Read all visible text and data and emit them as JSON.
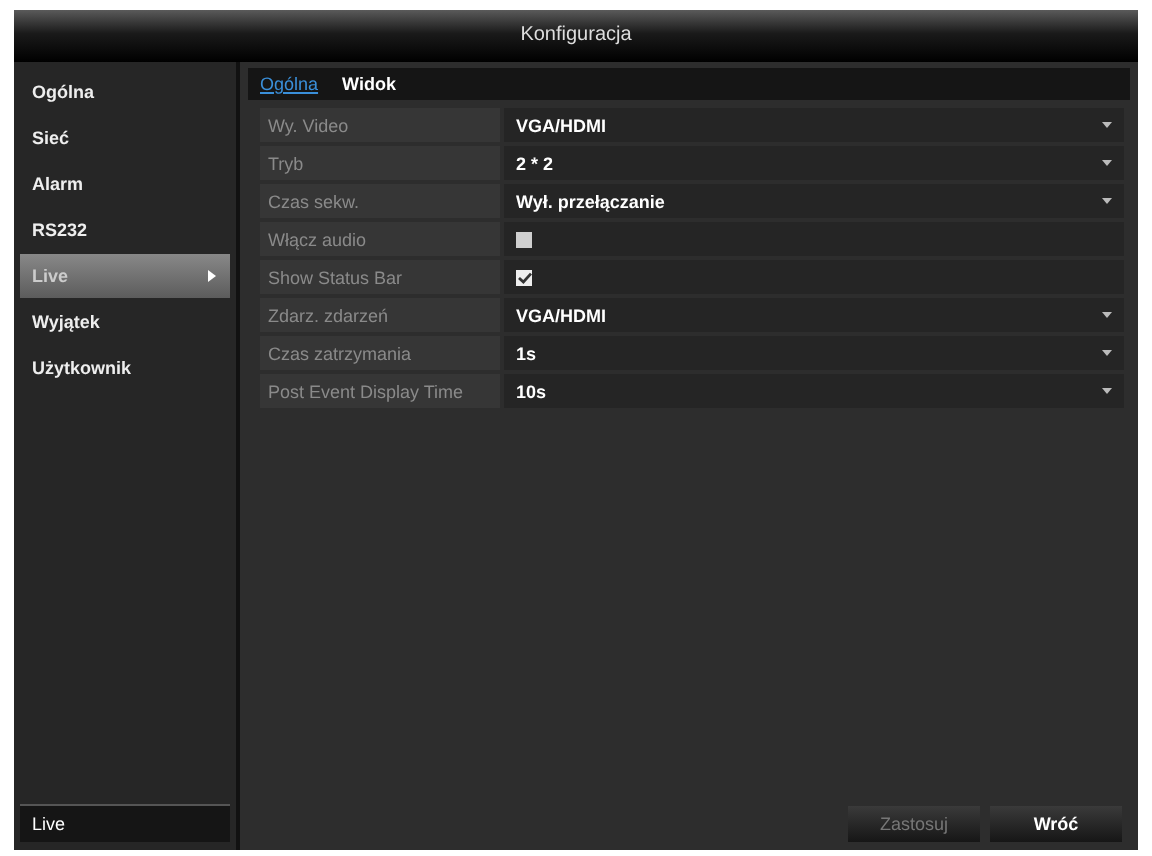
{
  "window": {
    "title": "Konfiguracja"
  },
  "sidebar": {
    "items": [
      {
        "label": "Ogólna",
        "selected": false
      },
      {
        "label": "Sieć",
        "selected": false
      },
      {
        "label": "Alarm",
        "selected": false
      },
      {
        "label": "RS232",
        "selected": false
      },
      {
        "label": "Live",
        "selected": true
      },
      {
        "label": "Wyjątek",
        "selected": false
      },
      {
        "label": "Użytkownik",
        "selected": false
      }
    ],
    "footer": "Live"
  },
  "tabs": [
    {
      "label": "Ogólna",
      "selected": true
    },
    {
      "label": "Widok",
      "selected": false
    }
  ],
  "settings": [
    {
      "kind": "select",
      "label": "Wy. Video",
      "value": "VGA/HDMI"
    },
    {
      "kind": "select",
      "label": "Tryb",
      "value": "2 * 2"
    },
    {
      "kind": "select",
      "label": "Czas sekw.",
      "value": "Wył. przełączanie"
    },
    {
      "kind": "checkbox",
      "label": "Włącz audio",
      "checked": false
    },
    {
      "kind": "checkbox",
      "label": "Show Status Bar",
      "checked": true
    },
    {
      "kind": "select",
      "label": "Zdarz. zdarzeń",
      "value": "VGA/HDMI"
    },
    {
      "kind": "select",
      "label": "Czas zatrzymania",
      "value": "1s"
    },
    {
      "kind": "select",
      "label": "Post Event Display Time",
      "value": "10s"
    }
  ],
  "buttons": [
    {
      "label": "Zastosuj",
      "disabled": true
    },
    {
      "label": "Wróć",
      "disabled": false
    }
  ]
}
